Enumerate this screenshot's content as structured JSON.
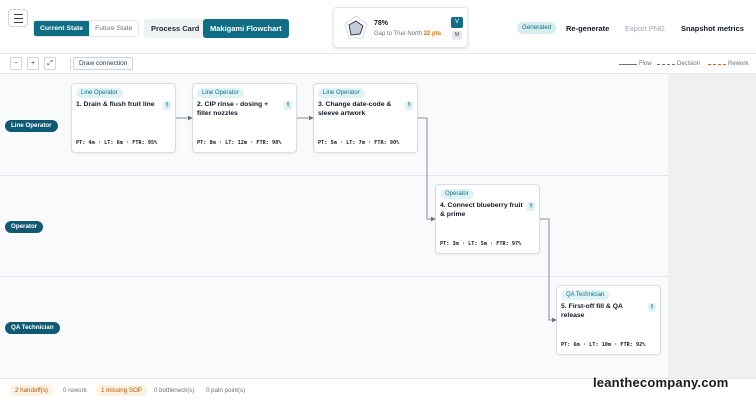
{
  "header": {
    "state_toggle": {
      "current": "Current State",
      "future": "Future State"
    },
    "tabs": {
      "process_card": "Process Card",
      "makigami": "Makigami Flowchart"
    },
    "score": {
      "percent": "78%",
      "gap_label": "Gap to True North",
      "gap_value": "22 pts",
      "badge_v": "V",
      "badge_m": "M"
    },
    "generated_badge": "Generated",
    "regenerate": "Re-generate",
    "export_png": "Export PNG",
    "snapshot_metrics": "Snapshot metrics"
  },
  "toolbar": {
    "zoom_out": "−",
    "zoom_in": "+",
    "fit": "⤢",
    "draw_connection": "Draw connection",
    "legend": {
      "flow": "Flow",
      "decision": "Decision",
      "rework": "Rework"
    }
  },
  "lanes": [
    {
      "label": "Line Operator"
    },
    {
      "label": "Operator"
    },
    {
      "label": "QA Technician"
    }
  ],
  "steps": [
    {
      "role": "Line Operator",
      "title": "1. Drain & flush fruit line",
      "sop": "§",
      "metrics": "PT: 4m · LT: 6m · FTR: 95%"
    },
    {
      "role": "Line Operator",
      "title": "2. CIP rinse - dosing + filler nozzles",
      "sop": "§",
      "metrics": "PT: 8m · LT: 12m · FTR: 98%"
    },
    {
      "role": "Line Operator",
      "title": "3. Change date-code & sleeve artwork",
      "sop": "§",
      "metrics": "PT: 5m · LT: 7m · FTR: 90%"
    },
    {
      "role": "Operator",
      "title": "4. Connect blueberry fruit & prime",
      "sop": "§",
      "metrics": "PT: 3m · LT: 5m · FTR: 97%"
    },
    {
      "role": "QA Technician",
      "title": "5. First-off fill & QA release",
      "sop": "§",
      "metrics": "PT: 6m · LT: 10m · FTR: 92%"
    }
  ],
  "footer": {
    "handoffs": "2 handoff(s)",
    "rework": "0 rework",
    "missing_sop": "1 missing SOP",
    "bottlenecks": "0 bottleneck(s)",
    "pain_points": "0 pain point(s)"
  },
  "watermark": "leanthecompany.com",
  "colors": {
    "accent": "#0f6e85",
    "lane_pill": "#0f5a72",
    "warning": "#b45309",
    "rework": "#ea580c"
  }
}
